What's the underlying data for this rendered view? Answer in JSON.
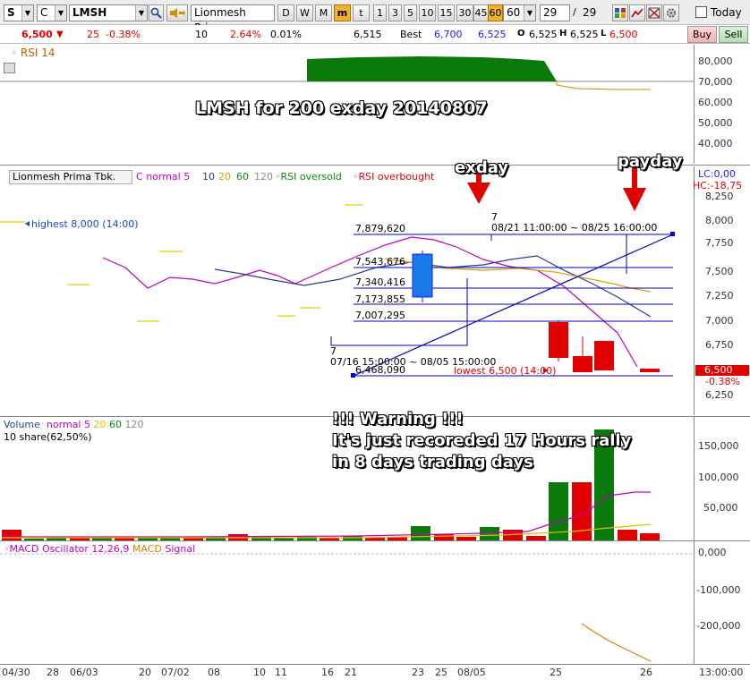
{
  "toolbar": {
    "market_code": "S",
    "chart_type_code": "C",
    "ticker": "LMSH",
    "company_name": "Lionmesh Prima",
    "period_buttons": [
      "D",
      "W",
      "M",
      "m",
      "t",
      "1",
      "3",
      "5",
      "10",
      "15",
      "30",
      "45",
      "60"
    ],
    "active_period": "m",
    "selected_interval": "60",
    "interval_select_value": "60",
    "page_current": "29",
    "page_total": "29",
    "today_label": "Today"
  },
  "quote": {
    "price": "6,500",
    "change": "25",
    "change_pct": "-0.38%",
    "volume_count": "10",
    "vol_pct": "2.64%",
    "turnover_pct": "0.01%",
    "prev": "6,515",
    "best_label": "Best",
    "best_bid": "6,700",
    "best_ask": "6,525",
    "open": "6,525",
    "high_label": "H",
    "high": "6,525",
    "low_label": "L",
    "low": "6,500",
    "buy_label": "Buy",
    "sell_label": "Sell"
  },
  "rsi_panel": {
    "title": "RSI 14",
    "ticks": [
      "80,000",
      "70,000",
      "60,000",
      "50,000",
      "40,000"
    ]
  },
  "annotations": {
    "headline": "LMSH for 200 exday 20140807",
    "exday_label": "exday",
    "payday_label": "payday",
    "warning_line1": "!!! Warning !!!",
    "warning_line2": "It's just recoreded 17 Hours rally",
    "warning_line3": "in 8 days trading days"
  },
  "price_panel": {
    "legend_name": "Lionmesh Prima Tbk.",
    "legend_c": "C",
    "legend_normal": "normal",
    "legend_ma": [
      "5",
      "10",
      "20",
      "60",
      "120"
    ],
    "legend_rsi_oversold": "RSI oversold",
    "legend_rsi_overbought": "RSI overbought",
    "lc_label": "LC:0,00",
    "hc_label": "HC:-18,75",
    "highest_label": "highest 8,000 (14:00)",
    "lowest_label": "lowest 6,500 (14:00)",
    "fib_levels": [
      "7,879,620",
      "7,543,676",
      "7,340,416",
      "7,173,855",
      "7,007,295",
      "6,468,090"
    ],
    "range_top_count": "7",
    "range_top": "08/21 11:00:00 ~ 08/25 16:00:00",
    "range_bottom_count": "7",
    "range_bottom": "07/16 15:00:00 ~ 08/05 15:00:00",
    "ticks": [
      "8,250",
      "8,000",
      "7,750",
      "7,500",
      "7,250",
      "7,000",
      "6,750",
      "6,500",
      "6,250"
    ],
    "last_price_tag": "6,500",
    "last_change_tag": "-0.38%"
  },
  "volume_panel": {
    "title": "Volume",
    "normal": "normal",
    "ma": [
      "5",
      "20",
      "60",
      "120"
    ],
    "share_label": "10 share(62,50%)",
    "ticks": [
      "150,000",
      "100,000",
      "50,000"
    ]
  },
  "macd_panel": {
    "title": "MACD Oscillator 12,26,9",
    "macd_label": "MACD",
    "signal_label": "Signal",
    "ticks": [
      "0,000",
      "-100,000",
      "-200,000"
    ]
  },
  "x_axis": {
    "labels": [
      "04/30",
      "28",
      "06/03",
      "20",
      "07/02",
      "08",
      "10",
      "11",
      "16",
      "21",
      "23",
      "25",
      "08/05",
      "25",
      "26"
    ],
    "time_label": "13:00:00"
  },
  "colors": {
    "up": "#e00000",
    "down": "#1a1aff",
    "rsi_fill": "#0a7a0a",
    "ma_magenta": "#c000c0",
    "ma_blue": "#2a3a9a",
    "ma_yellow": "#e0d000",
    "ma_orange": "#e08000",
    "annotation_line": "#0000cc"
  },
  "chart_data": [
    {
      "type": "line",
      "title": "RSI 14",
      "y_ticks": [
        80000,
        70000,
        60000,
        50000,
        40000
      ],
      "series": [
        {
          "name": "RSI 14",
          "values": [
            79000,
            80000,
            80000,
            79500,
            79000,
            79000,
            78500,
            78000,
            71000,
            68000,
            66800,
            66500,
            66500
          ]
        }
      ]
    },
    {
      "type": "candlestick",
      "title": "Lionmesh Prima Tbk.",
      "y_ticks": [
        8250,
        8000,
        7750,
        7500,
        7250,
        7000,
        6750,
        6500,
        6250
      ],
      "candles": [
        {
          "open": 7250,
          "close": 7650,
          "high": 7680,
          "low": 7200
        },
        {
          "open": 7000,
          "close": 6650,
          "high": 7000,
          "low": 6620
        },
        {
          "open": 6650,
          "close": 6520,
          "high": 6650,
          "low": 6500
        },
        {
          "open": 6800,
          "close": 6520,
          "high": 6800,
          "low": 6520
        },
        {
          "open": 6525,
          "close": 6500,
          "high": 6525,
          "low": 6500
        }
      ]
    },
    {
      "type": "bar",
      "title": "Volume",
      "y_ticks": [
        150000,
        100000,
        50000
      ],
      "values": [
        16000,
        1500,
        5000,
        5000,
        3000,
        4000,
        5000,
        3000,
        4000,
        3500,
        10000,
        5000,
        4000,
        5000,
        4500,
        3500,
        7000,
        4000,
        5000,
        30000,
        10000,
        5000,
        27000,
        20000,
        10000,
        92000,
        92000,
        180000,
        20000,
        12000
      ]
    },
    {
      "type": "line",
      "title": "MACD Oscillator 12,26,9",
      "y_ticks": [
        0,
        -100000,
        -200000
      ],
      "series": [
        {
          "name": "MACD",
          "values": [
            -190000,
            -215000,
            -240000,
            -265000,
            -285000
          ]
        }
      ]
    }
  ]
}
